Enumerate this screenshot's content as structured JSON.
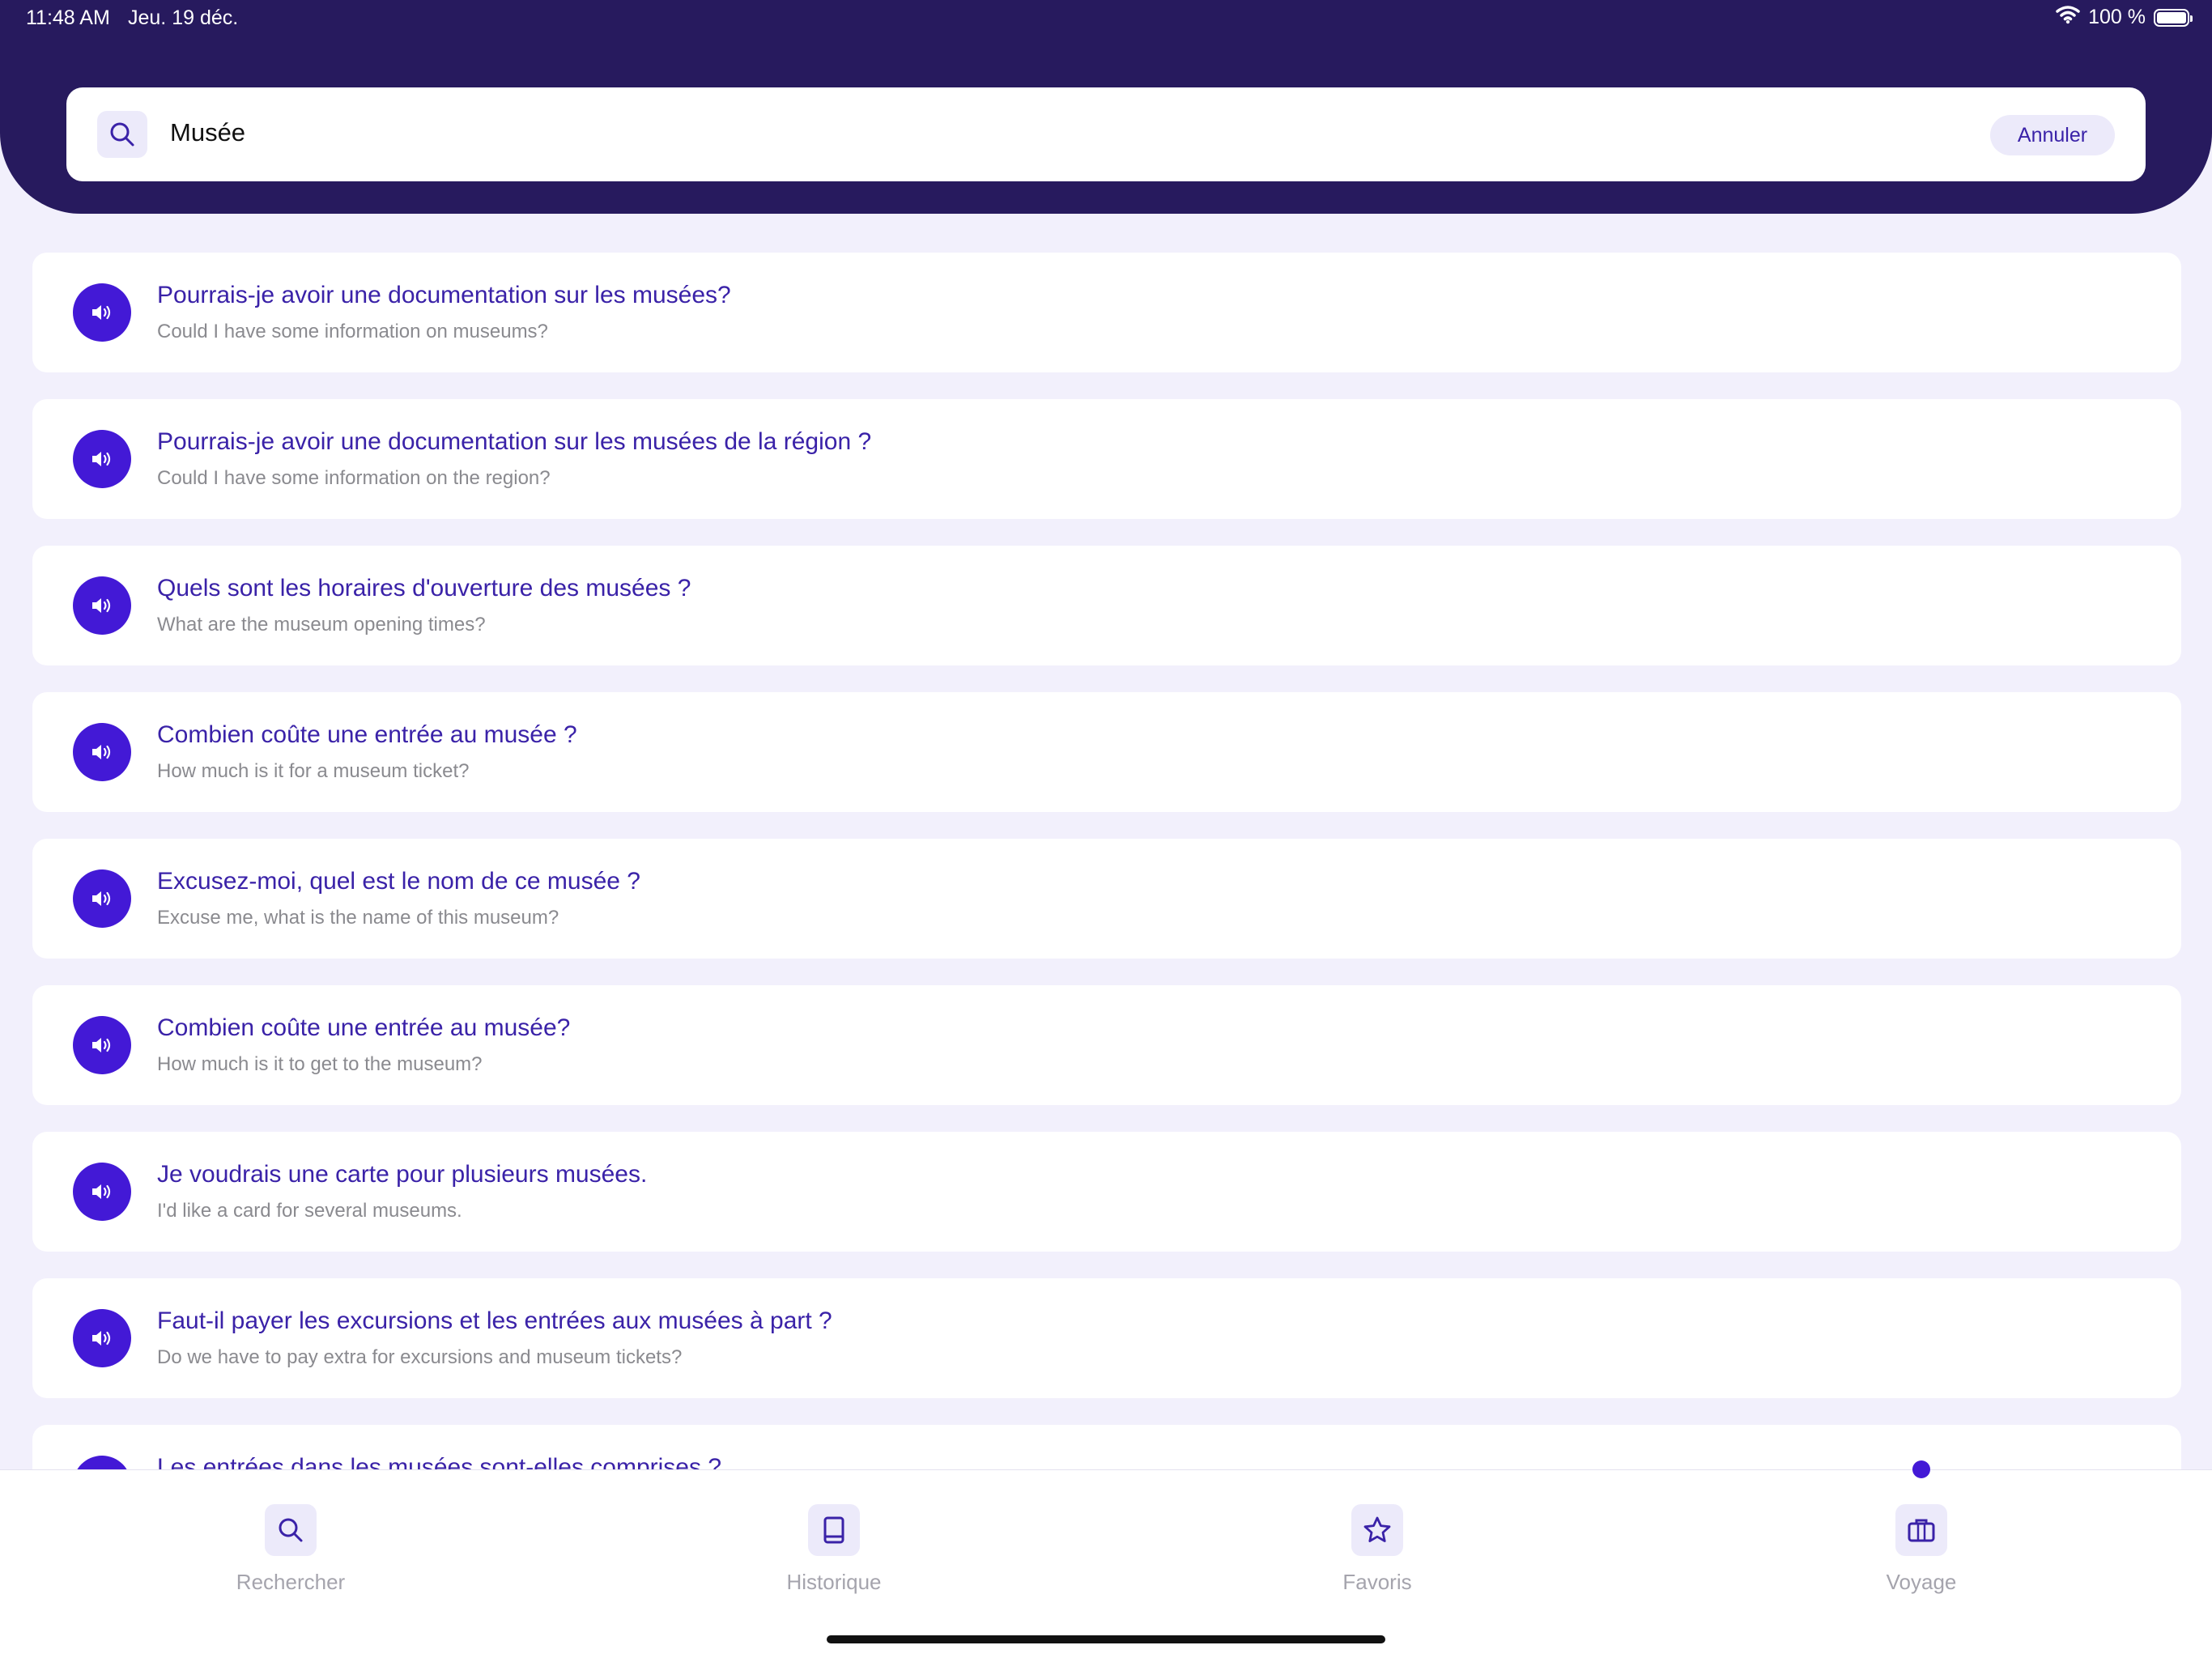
{
  "status_bar": {
    "time": "11:48 AM",
    "date": "Jeu. 19 déc.",
    "battery": "100 %"
  },
  "search": {
    "icon": "search-icon",
    "value": "Musée",
    "cancel_label": "Annuler"
  },
  "results": [
    {
      "phrase": "Pourrais-je avoir une documentation sur les musées?",
      "translation": "Could I have some information on museums?"
    },
    {
      "phrase": "Pourrais-je avoir une documentation sur les musées de la région ?",
      "translation": "Could I have some information on the region?"
    },
    {
      "phrase": "Quels sont les horaires d'ouverture des musées ?",
      "translation": "What are the museum opening times?"
    },
    {
      "phrase": "Combien coûte une entrée au musée ?",
      "translation": "How much is it for a museum ticket?"
    },
    {
      "phrase": "Excusez-moi, quel est le nom de ce musée ?",
      "translation": "Excuse me, what is the name of this museum?"
    },
    {
      "phrase": "Combien coûte une entrée au musée?",
      "translation": "How much is it to get to the museum?"
    },
    {
      "phrase": "Je voudrais une carte pour plusieurs musées.",
      "translation": "I'd like a card for several museums."
    },
    {
      "phrase": "Faut-il payer les excursions et les entrées aux musées à part ?",
      "translation": "Do we have to pay extra for excursions and museum tickets?"
    },
    {
      "phrase": "Les entrées dans les musées sont-elles comprises ?",
      "translation": ""
    }
  ],
  "tabs": [
    {
      "label": "Rechercher",
      "icon": "search-icon"
    },
    {
      "label": "Historique",
      "icon": "book-icon"
    },
    {
      "label": "Favoris",
      "icon": "star-icon"
    },
    {
      "label": "Voyage",
      "icon": "briefcase-icon"
    }
  ],
  "colors": {
    "header": "#271a5e",
    "accent": "#4319d6",
    "phrase_text": "#3a22a8",
    "background": "#f2f0fc"
  }
}
